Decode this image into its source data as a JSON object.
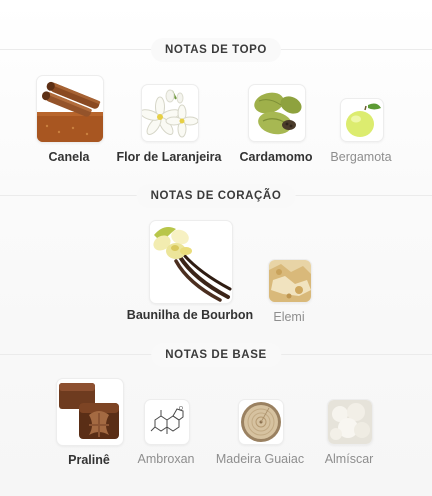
{
  "sections": [
    {
      "title": "NOTAS DE TOPO",
      "notes": [
        {
          "name": "Canela",
          "icon": "cinnamon-image",
          "emphasis": "primary"
        },
        {
          "name": "Flor de Laranjeira",
          "icon": "orange-blossom-image",
          "emphasis": "primary"
        },
        {
          "name": "Cardamomo",
          "icon": "cardamom-image",
          "emphasis": "primary"
        },
        {
          "name": "Bergamota",
          "icon": "bergamot-image",
          "emphasis": "secondary"
        }
      ]
    },
    {
      "title": "NOTAS DE CORAÇÃO",
      "notes": [
        {
          "name": "Baunilha de Bourbon",
          "icon": "vanilla-image",
          "emphasis": "primary"
        },
        {
          "name": "Elemi",
          "icon": "elemi-resin-image",
          "emphasis": "secondary"
        }
      ]
    },
    {
      "title": "NOTAS DE BASE",
      "notes": [
        {
          "name": "Pralinê",
          "icon": "praline-image",
          "emphasis": "primary"
        },
        {
          "name": "Ambroxan",
          "icon": "molecule-image",
          "emphasis": "secondary"
        },
        {
          "name": "Madeira Guaiac",
          "icon": "wood-slice-image",
          "emphasis": "secondary"
        },
        {
          "name": "Almíscar",
          "icon": "musk-image",
          "emphasis": "secondary"
        }
      ]
    }
  ]
}
